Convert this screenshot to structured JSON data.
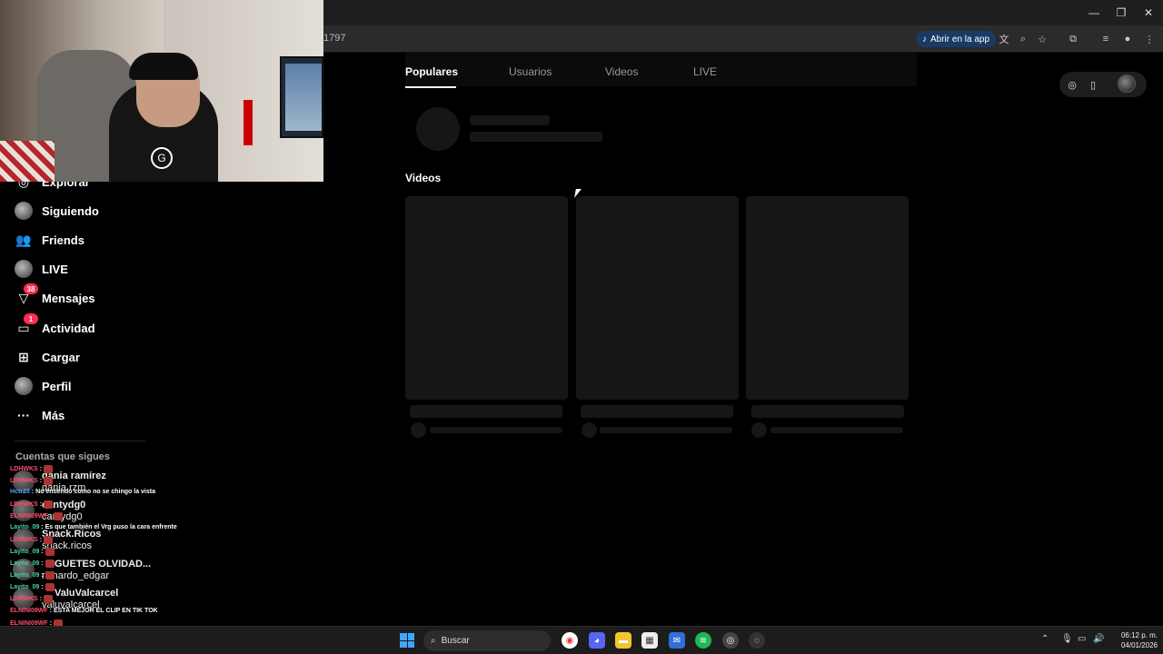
{
  "browser": {
    "url_fragment": "1797",
    "open_in_app": "Abrir en la app"
  },
  "sidebar": {
    "items": [
      {
        "label": "Explorar",
        "icon": "compass-icon"
      },
      {
        "label": "Siguiendo",
        "icon": "avatar-icon"
      },
      {
        "label": "Friends",
        "icon": "friends-icon"
      },
      {
        "label": "LIVE",
        "icon": "live-avatar-icon"
      },
      {
        "label": "Mensajes",
        "icon": "message-icon",
        "badge": "38"
      },
      {
        "label": "Actividad",
        "icon": "activity-icon",
        "badge": "1"
      },
      {
        "label": "Cargar",
        "icon": "upload-icon"
      },
      {
        "label": "Perfil",
        "icon": "profile-avatar-icon"
      },
      {
        "label": "Más",
        "icon": "more-icon"
      }
    ],
    "following_title": "Cuentas que sigues",
    "following": [
      "dania ramírez",
      "dania.rzm",
      "cantydg0",
      "cantydg0",
      "Snack.Ricos",
      "snack.ricos",
      "GUETES OLVIDAD...",
      "richardo_edgar",
      "ValuValcarcel",
      "valuvalcarcel"
    ]
  },
  "chat": [
    {
      "user": "LDHWKS",
      "msg": ""
    },
    {
      "user": "LDHWKS",
      "msg": ""
    },
    {
      "user": "Hctr23",
      "msg": "No entiendo como no se chingo la vista"
    },
    {
      "user": "LDHWKS",
      "msg": ""
    },
    {
      "user": "ELNINI09WF",
      "msg": ""
    },
    {
      "user": "Layito_09",
      "msg": "Es que también el Vrg puso la cara enfrente"
    },
    {
      "user": "LDHWKS",
      "msg": ""
    },
    {
      "user": "Layito_09",
      "msg": ""
    },
    {
      "user": "Layito_09",
      "msg": ""
    },
    {
      "user": "Layito_09",
      "msg": ""
    },
    {
      "user": "Layito_09",
      "msg": ""
    },
    {
      "user": "LDHWKS",
      "msg": ""
    },
    {
      "user": "ELNINI09WF",
      "msg": "ESTA MEJOR EL CLIP EN TIK TOK"
    },
    {
      "user": "ELNINI09WF",
      "msg": ""
    },
    {
      "user": "LDHWKS",
      "msg": ""
    },
    {
      "user": "LDHWKS",
      "msg": ""
    }
  ],
  "main": {
    "tabs": [
      "Populares",
      "Usuarios",
      "Videos",
      "LIVE"
    ],
    "active_tab": "Populares",
    "videos_title": "Videos"
  },
  "taskbar": {
    "search_label": "Buscar",
    "time": "06:12 p. m.",
    "date": "04/01/2026"
  },
  "colors": {
    "accent": "#fe2c55",
    "skeleton": "#161616",
    "background": "#000000"
  }
}
